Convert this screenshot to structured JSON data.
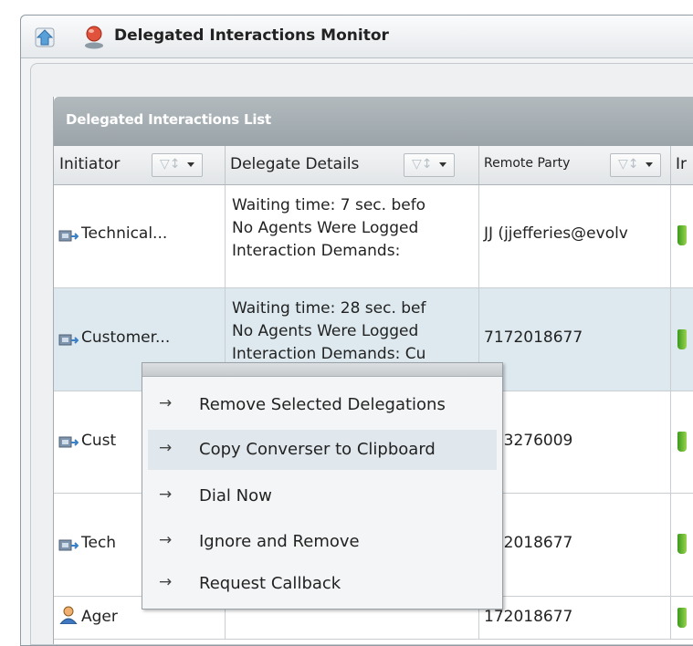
{
  "window": {
    "title": "Delegated Interactions Monitor"
  },
  "panel": {
    "title": "Delegated Interactions List"
  },
  "columns": [
    {
      "label": "Initiator"
    },
    {
      "label": "Delegate Details"
    },
    {
      "label": "Remote Party"
    },
    {
      "label": "Ir"
    }
  ],
  "rows": [
    {
      "initiator": "Technical...",
      "details": "Waiting time: 7 sec. befo\nNo Agents Were Logged\nInteraction Demands:",
      "remote": "JJ (jjefferies@evolv"
    },
    {
      "initiator": "Customer...",
      "details": "Waiting time: 28 sec. bef\nNo Agents Were Logged\nInteraction Demands: Cu",
      "remote": "7172018677"
    },
    {
      "initiator": "Cust",
      "details": "",
      "remote": "303276009"
    },
    {
      "initiator": "Tech",
      "details": "",
      "remote": "172018677"
    },
    {
      "initiator": "Ager",
      "details": "",
      "remote": "172018677"
    }
  ],
  "context_menu": {
    "items": [
      {
        "label": "Remove Selected Delegations"
      },
      {
        "label": "Copy Converser to Clipboard"
      },
      {
        "label": "Dial Now"
      },
      {
        "label": "Ignore and Remove"
      },
      {
        "label": "Request Callback"
      }
    ]
  },
  "colors": {
    "header_bg": "#9ba4a9",
    "selected_row": "#dde9ef",
    "menu_highlight": "#e0e8ed"
  }
}
